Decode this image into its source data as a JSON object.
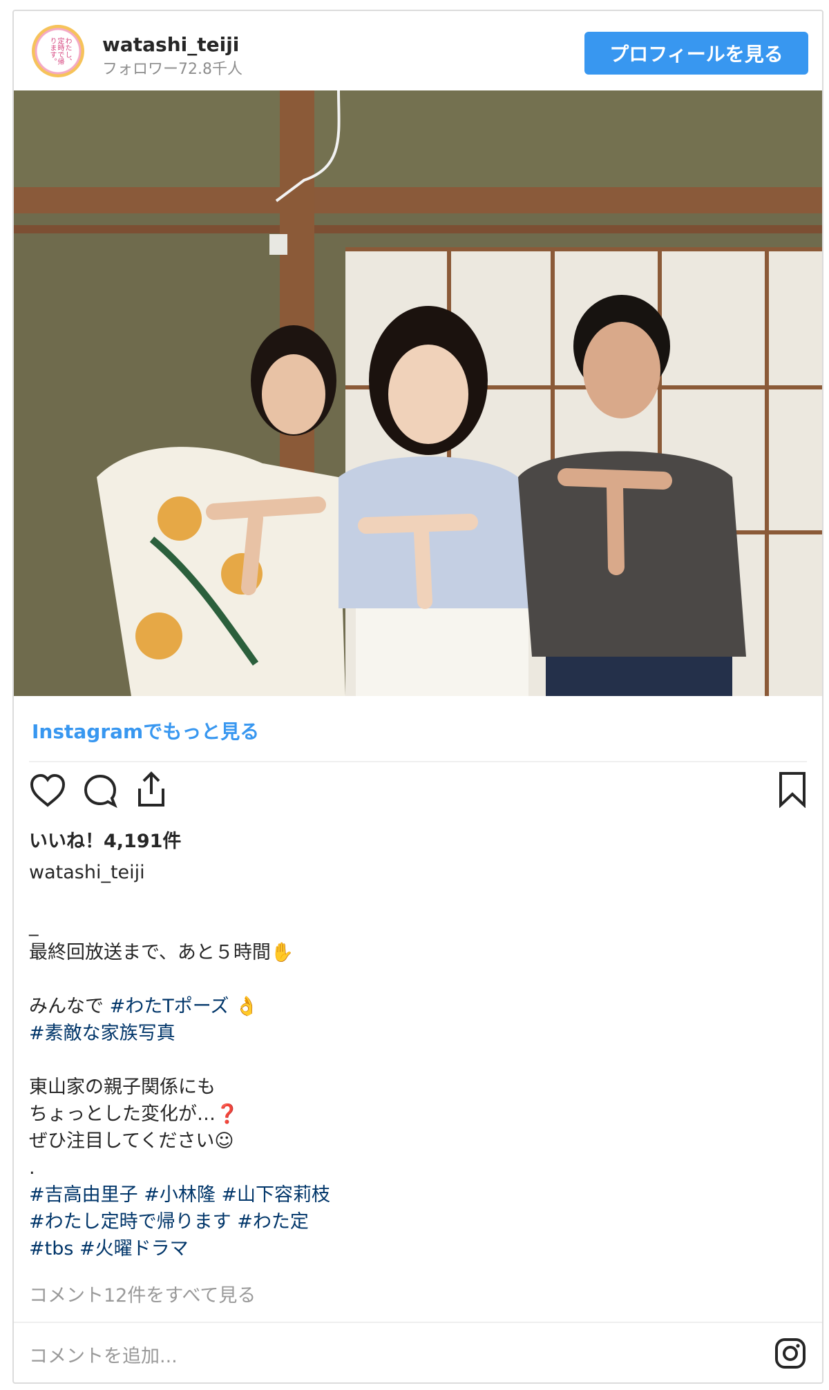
{
  "header": {
    "username": "watashi_teiji",
    "followers": "フォロワー72.8千人",
    "profile_button": "プロフィールを見る",
    "avatar_text": "わたし、定時で帰ります。"
  },
  "post": {
    "more_link": "Instagramでもっと見る",
    "likes": "いいね！4,191件",
    "caption_user": "watashi_teiji",
    "caption_lines": [
      {
        "text": "_",
        "tags": []
      },
      {
        "text": "最終回放送まで、あと５時間✋",
        "tags": []
      },
      {
        "text": "",
        "tags": []
      },
      {
        "text": "みんなで ",
        "tags": [
          "#わたTポーズ"
        ],
        "suffix": " 👌"
      },
      {
        "text": "",
        "tags": [
          "#素敵な家族写真"
        ]
      },
      {
        "text": "",
        "tags": []
      },
      {
        "text": "東山家の親子関係にも",
        "tags": []
      },
      {
        "text": "ちょっとした変化が…❓",
        "tags": []
      },
      {
        "text": "ぜひ注目してください☺",
        "tags": []
      },
      {
        "text": ".",
        "tags": []
      },
      {
        "text": "",
        "tags": [
          "#吉高由里子",
          "#小林隆",
          "#山下容莉枝"
        ]
      },
      {
        "text": "",
        "tags": [
          "#わたし定時で帰ります",
          "#わた定"
        ]
      },
      {
        "text": "",
        "tags": [
          "#tbs",
          "#火曜ドラマ"
        ]
      }
    ],
    "comments_link": "コメント12件をすべて見る",
    "comment_placeholder": "コメントを追加..."
  },
  "icons": {
    "like": "heart-icon",
    "comment": "comment-icon",
    "share": "share-icon",
    "save": "bookmark-icon",
    "instagram": "instagram-logo-icon"
  },
  "colors": {
    "accent": "#3897f0",
    "hashtag": "#003569",
    "muted": "#8e8e8e"
  }
}
